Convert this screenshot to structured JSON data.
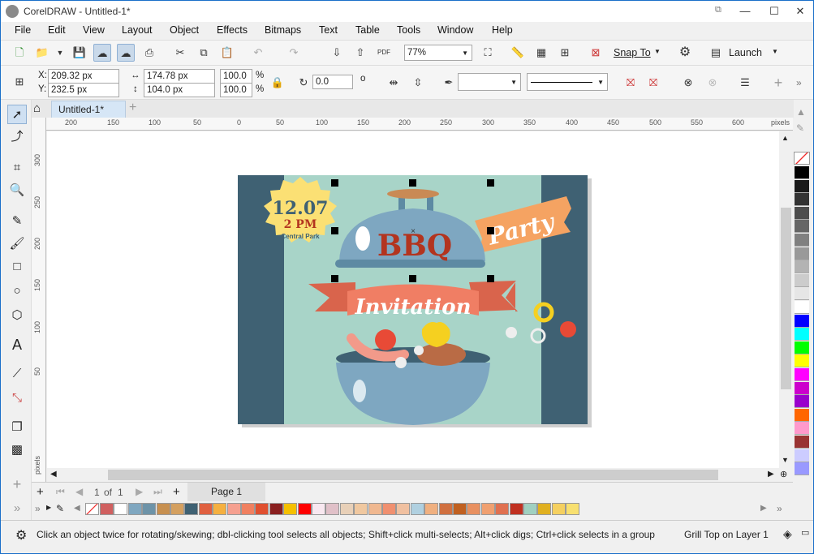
{
  "window": {
    "title": "CorelDRAW - Untitled-1*",
    "min": "—",
    "max": "☐",
    "close": "✕"
  },
  "menu": [
    "File",
    "Edit",
    "View",
    "Layout",
    "Object",
    "Effects",
    "Bitmaps",
    "Text",
    "Table",
    "Tools",
    "Window",
    "Help"
  ],
  "toolbar": {
    "zoom": "77%",
    "snap_to": "Snap To",
    "launch": "Launch"
  },
  "property_bar": {
    "x_label": "X:",
    "x_value": "209.32 px",
    "y_label": "Y:",
    "y_value": "232.5 px",
    "w_value": "174.78 px",
    "h_value": "104.0 px",
    "scale_w": "100.0",
    "scale_h": "100.0",
    "pct": "%",
    "rotation": "0.0",
    "degree": "o"
  },
  "document_tab": "Untitled-1*",
  "ruler": {
    "units": "pixels",
    "h_ticks": [
      "200",
      "150",
      "100",
      "50",
      "0",
      "50",
      "100",
      "150",
      "200",
      "250",
      "300",
      "350",
      "400",
      "450",
      "500",
      "550",
      "600"
    ],
    "v_ticks": [
      "300",
      "250",
      "200",
      "150",
      "100",
      "50"
    ],
    "v_units": "pixels"
  },
  "design": {
    "date": "12.07",
    "time": "2 PM",
    "place": "Central Park",
    "bbq": "BBQ",
    "party": "Party",
    "invitation": "Invitation"
  },
  "page_nav": {
    "current": "1",
    "of_label": "of",
    "total": "1",
    "page_tab": "Page 1"
  },
  "status": {
    "hint": "Click an object twice for rotating/skewing; dbl-clicking tool selects all objects; Shift+click multi-selects; Alt+click digs; Ctrl+click selects in a group",
    "selection": "Grill Top on Layer 1"
  },
  "colors": {
    "accent": "#1a6fc9",
    "card_bg": "#a8d4c8",
    "card_side": "#3f6173",
    "grill": "#7ea7c1",
    "bbq_text": "#b3341f",
    "ribbon": "#f07e64",
    "party_ribbon": "#f5a362",
    "badge": "#fbe074"
  },
  "palette_bottom": [
    "#d06060",
    "#ffffff",
    "#7fa7c0",
    "#6d93a8",
    "#c79050",
    "#d4a060",
    "#3f6173",
    "#e06040",
    "#f5b040",
    "#f5a090",
    "#f08060",
    "#e05030",
    "#8a2020",
    "#f5c000",
    "#ff0000",
    "#f8e8f0",
    "#e0c0c8",
    "#e8d0b8",
    "#f0c8a0",
    "#f0b890",
    "#f09070",
    "#f0c0a0",
    "#b0d0e0",
    "#f0b080",
    "#d07040",
    "#c06020",
    "#e89060",
    "#f0a070",
    "#e07050",
    "#c03020",
    "#a0d0c0",
    "#e0b020",
    "#f5d060",
    "#f8e070"
  ],
  "palette_right": [
    "#000000",
    "#1a1a1a",
    "#333333",
    "#4d4d4d",
    "#666666",
    "#808080",
    "#999999",
    "#b3b3b3",
    "#cccccc",
    "#e6e6e6",
    "#ffffff",
    "#0000ff",
    "#00ffff",
    "#00ff00",
    "#ffff00",
    "#ff00ff",
    "#cc00cc",
    "#9900cc",
    "#ff6600",
    "#ff99cc",
    "#993333",
    "#ccccff",
    "#9999ff"
  ]
}
